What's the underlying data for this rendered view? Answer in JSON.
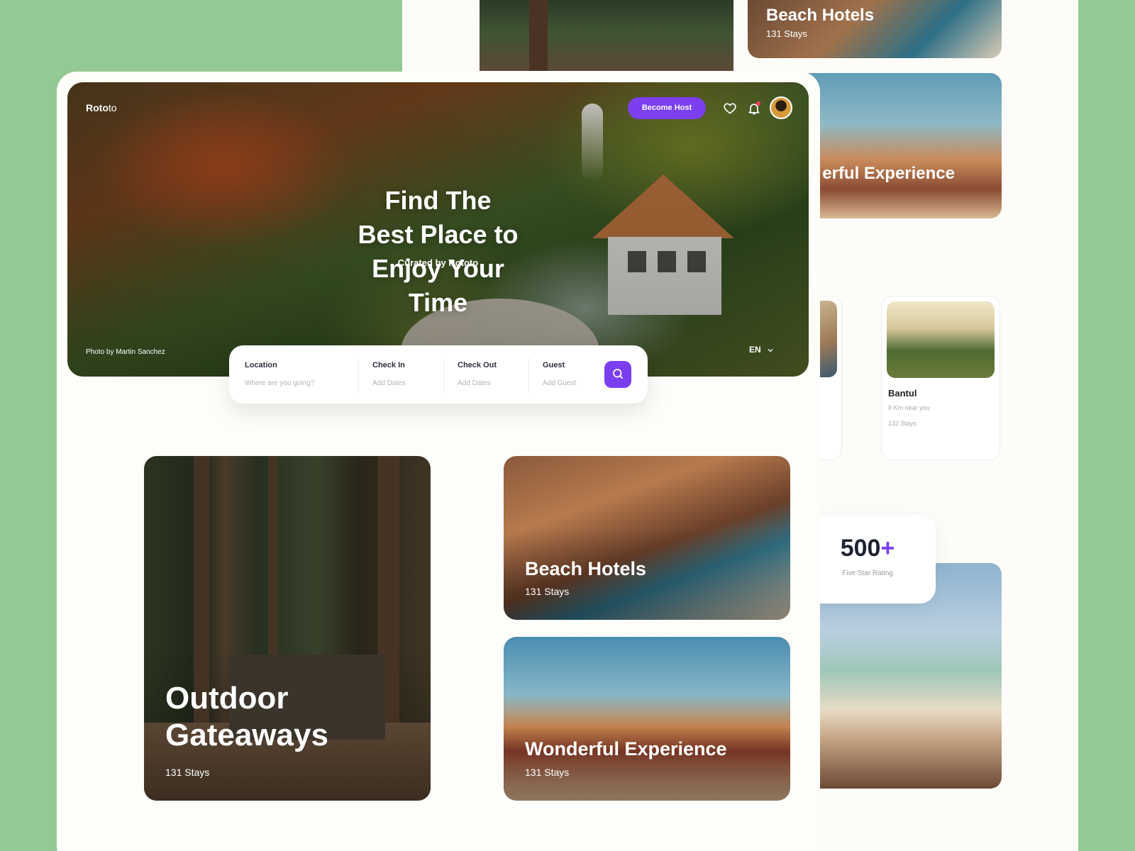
{
  "app": {
    "logo_bold": "Roto",
    "logo_light": "to"
  },
  "header": {
    "become_host_label": "Become Host",
    "language": "EN"
  },
  "hero": {
    "title": "Find The Best Place to Enjoy Your Time",
    "subtitle": "Curated by Rototo",
    "photo_credit": "Photo by Martin Sanchez"
  },
  "search": {
    "location_label": "Location",
    "location_placeholder": "Where are you going?",
    "checkin_label": "Check In",
    "checkin_placeholder": "Add Dates",
    "checkout_label": "Check Out",
    "checkout_placeholder": "Add Dates",
    "guest_label": "Guest",
    "guest_placeholder": "Add Guest"
  },
  "categories": [
    {
      "title": "Outdoor Gateaways",
      "count": "131 Stays"
    },
    {
      "title": "Beach Hotels",
      "count": "131 Stays"
    },
    {
      "title": "Wonderful Experience",
      "count": "131 Stays"
    }
  ],
  "back_mockup": {
    "beach_title": "Beach Hotels",
    "beach_count": "131 Stays",
    "camel_title": "erful Experience",
    "place_name": "Bantul",
    "place_distance": "8 Km near you",
    "place_stays": "132 Stays",
    "rating_number": "500",
    "rating_plus": "+",
    "rating_label": "Five Star Rating"
  },
  "colors": {
    "accent": "#7b3ff0",
    "background": "#93c993",
    "notification_dot": "#ff3b5c"
  },
  "icons": [
    "heart-icon",
    "bell-icon",
    "search-icon",
    "chevron-down-icon"
  ]
}
